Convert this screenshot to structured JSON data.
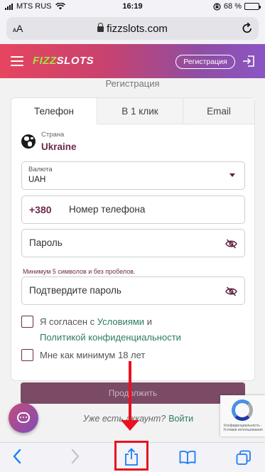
{
  "status_bar": {
    "carrier": "MTS RUS",
    "time": "16:19",
    "battery": "68 %",
    "battery_level": 0.68
  },
  "browser": {
    "text_size_label": "AA",
    "url": "fizzslots.com"
  },
  "site_header": {
    "logo_part1": "FIZZ",
    "logo_part2": "SLOTS",
    "register_button": "Регистрация"
  },
  "form": {
    "title": "Регистрация",
    "tabs": [
      {
        "label": "Телефон",
        "active": true
      },
      {
        "label": "В 1 клик",
        "active": false
      },
      {
        "label": "Email",
        "active": false
      }
    ],
    "country": {
      "label": "Страна",
      "value": "Ukraine"
    },
    "currency": {
      "label": "Валюта",
      "value": "UAH"
    },
    "phone": {
      "prefix": "+380",
      "placeholder": "Номер телефона"
    },
    "password": {
      "placeholder": "Пароль",
      "hint": "Минимум 5 символов и без пробелов."
    },
    "confirm_password": {
      "placeholder": "Подтвердите пароль"
    },
    "terms": {
      "prefix": "Я согласен с",
      "terms_link": "Условиями",
      "and": "и",
      "privacy_link": "Политикой конфиденциальности"
    },
    "age": "Мне как минимум 18 лет",
    "continue_button": "Продолжить",
    "have_account": "Уже есть аккаунт?",
    "login_link": "Войти"
  },
  "recaptcha": {
    "text": "Конфиденциальность - Условия использования"
  },
  "toolbar": {
    "icons": [
      "back-icon",
      "forward-icon",
      "share-icon",
      "bookmarks-icon",
      "tabs-icon"
    ]
  },
  "colors": {
    "brand_maroon": "#6e2a4e",
    "link_green": "#2f7a5d",
    "annotation_red": "#e8121e",
    "ios_blue": "#1a7cf5"
  }
}
